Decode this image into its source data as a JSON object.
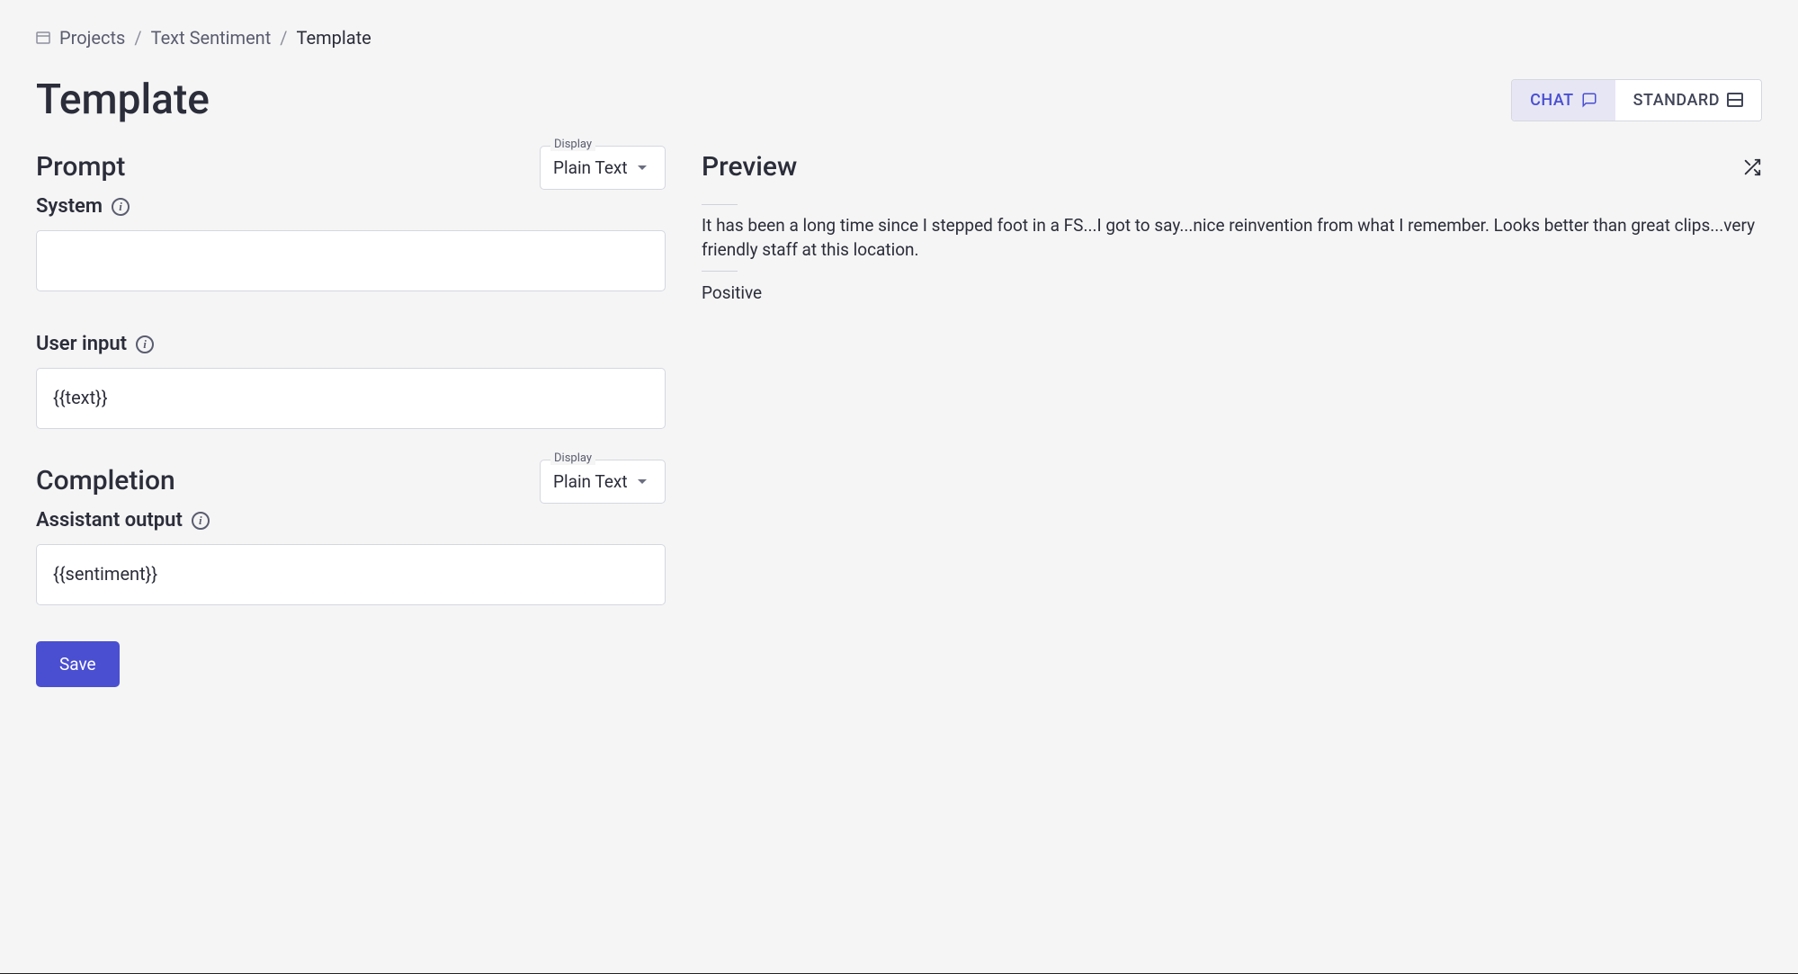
{
  "breadcrumb": {
    "projects": "Projects",
    "project_name": "Text Sentiment",
    "current": "Template"
  },
  "header": {
    "title": "Template",
    "toggle": {
      "chat": "CHAT",
      "standard": "STANDARD"
    }
  },
  "prompt": {
    "title": "Prompt",
    "display_label": "Display",
    "display_value": "Plain Text",
    "system_label": "System",
    "system_value": "",
    "user_input_label": "User input",
    "user_input_value": "{{text}}"
  },
  "completion": {
    "title": "Completion",
    "display_label": "Display",
    "display_value": "Plain Text",
    "assistant_label": "Assistant output",
    "assistant_value": "{{sentiment}}"
  },
  "actions": {
    "save": "Save"
  },
  "preview": {
    "title": "Preview",
    "text": "It has been a long time since I stepped foot in a FS...I got to say...nice reinvention from what I remember. Looks better than great clips...very friendly staff at this location.",
    "result": "Positive"
  }
}
